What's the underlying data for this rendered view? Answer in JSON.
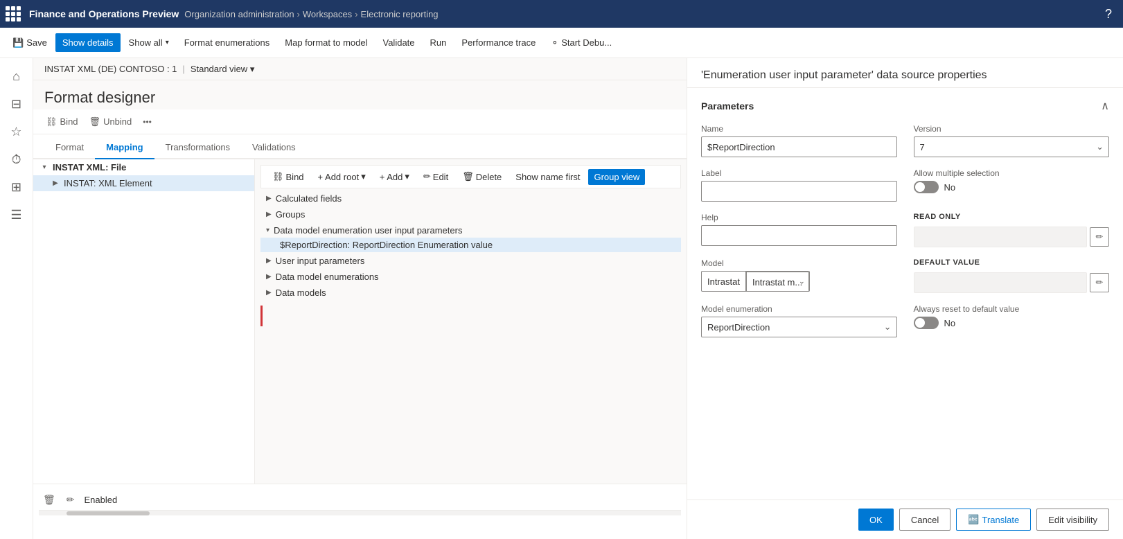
{
  "app": {
    "name": "Finance and Operations Preview"
  },
  "breadcrumb": {
    "items": [
      {
        "label": "Organization administration"
      },
      {
        "label": "Workspaces"
      },
      {
        "label": "Electronic reporting"
      }
    ]
  },
  "cmdbar": {
    "save": "Save",
    "show_details": "Show details",
    "show_all": "Show all",
    "format_enumerations": "Format enumerations",
    "map_format": "Map format to model",
    "validate": "Validate",
    "run": "Run",
    "performance_trace": "Performance trace",
    "start_debug": "Start Debu..."
  },
  "sub_breadcrumb": {
    "item1": "INSTAT XML (DE) CONTOSO : 1",
    "separator": "|",
    "view": "Standard view"
  },
  "page_title": "Format designer",
  "toolbar": {
    "bind": "Bind",
    "unbind": "Unbind"
  },
  "tabs": {
    "items": [
      {
        "label": "Format",
        "active": false
      },
      {
        "label": "Mapping",
        "active": true
      },
      {
        "label": "Transformations",
        "active": false
      },
      {
        "label": "Validations",
        "active": false
      }
    ]
  },
  "tree": {
    "items": [
      {
        "label": "INSTAT XML: File",
        "indent": 0,
        "expanded": true,
        "bold": true
      },
      {
        "label": "INSTAT: XML Element",
        "indent": 1,
        "expanded": false,
        "bold": false
      }
    ]
  },
  "mapping": {
    "toolbar": {
      "bind": "Bind",
      "add_root": "+ Add root",
      "add": "+ Add",
      "edit": "Edit",
      "delete": "Delete",
      "show_name_first": "Show name first",
      "group_view": "Group view"
    },
    "sections": [
      {
        "label": "Calculated fields",
        "expanded": false
      },
      {
        "label": "Groups",
        "expanded": false
      },
      {
        "label": "Data model enumeration user input parameters",
        "expanded": true
      },
      {
        "label": "User input parameters",
        "expanded": false
      },
      {
        "label": "Data model enumerations",
        "expanded": false
      },
      {
        "label": "Data models",
        "expanded": false
      }
    ],
    "selected_item": "$ReportDirection: ReportDirection Enumeration value"
  },
  "bottom": {
    "enabled_label": "Enabled"
  },
  "right_panel": {
    "title": "'Enumeration user input parameter' data source properties",
    "section": "Parameters",
    "fields": {
      "name_label": "Name",
      "name_value": "$ReportDirection",
      "version_label": "Version",
      "version_value": "7",
      "label_label": "Label",
      "label_value": "",
      "allow_multiple_label": "Allow multiple selection",
      "allow_multiple_toggle": "No",
      "help_label": "Help",
      "help_value": "",
      "read_only_label": "READ ONLY",
      "read_only_value": "",
      "model_label": "Model",
      "model_value_left": "Intrastat",
      "model_value_right": "Intrastat m...",
      "default_value_label": "DEFAULT VALUE",
      "default_value_value": "",
      "model_enumeration_label": "Model enumeration",
      "model_enumeration_value": "ReportDirection",
      "always_reset_label": "Always reset to default value",
      "always_reset_toggle": "No"
    },
    "footer": {
      "ok": "OK",
      "cancel": "Cancel",
      "translate": "Translate",
      "edit_visibility": "Edit visibility"
    }
  }
}
